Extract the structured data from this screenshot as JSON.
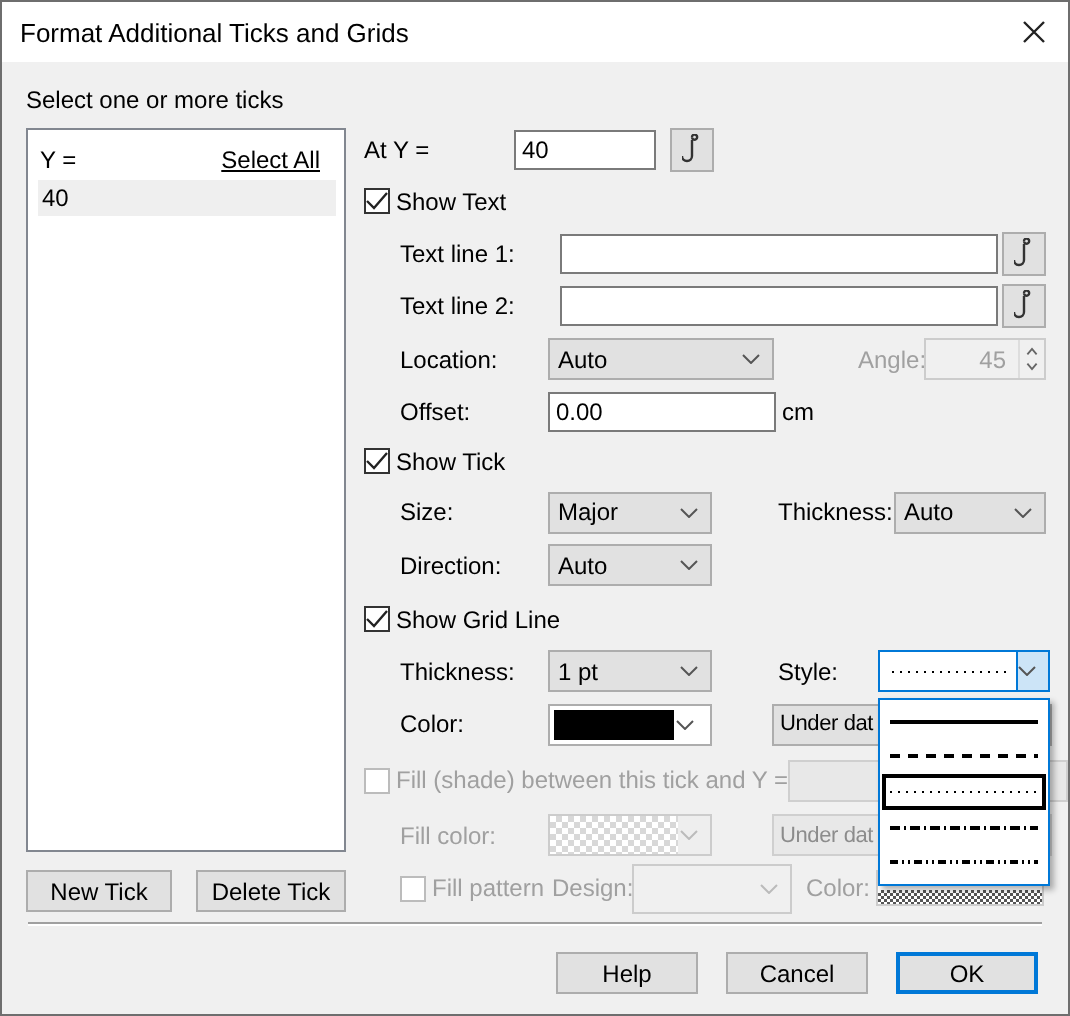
{
  "window": {
    "title": "Format Additional Ticks and Grids"
  },
  "tick_list": {
    "label": "Select one or more ticks",
    "header": "Y =",
    "select_all": "Select All",
    "items": [
      {
        "value": "40",
        "selected": true
      }
    ]
  },
  "list_buttons": [
    "New Tick",
    "Delete Tick"
  ],
  "at_y": {
    "label": "At Y =",
    "value": "40"
  },
  "show_text": {
    "label": "Show Text",
    "checked": true
  },
  "text_line_1": {
    "label": "Text line 1:"
  },
  "text_line_2": {
    "label": "Text line 2:"
  },
  "location": {
    "label": "Location:",
    "value": "Auto"
  },
  "angle": {
    "label": "Angle:",
    "value": "45",
    "disabled": true
  },
  "offset": {
    "label": "Offset:",
    "value": "0.00",
    "unit": "cm"
  },
  "show_tick": {
    "label": "Show Tick",
    "checked": true
  },
  "size": {
    "label": "Size:",
    "value": "Major"
  },
  "tick_thickness": {
    "label": "Thickness:",
    "value": "Auto"
  },
  "direction": {
    "label": "Direction:",
    "value": "Auto"
  },
  "show_grid_line": {
    "label": "Show Grid Line",
    "checked": true
  },
  "grid_thickness": {
    "label": "Thickness:",
    "value": "1 pt"
  },
  "style": {
    "label": "Style:",
    "expanded": true,
    "options": [
      {
        "kind": "solid",
        "selected": false
      },
      {
        "kind": "dash",
        "selected": false
      },
      {
        "kind": "dot",
        "selected": true
      },
      {
        "kind": "dash-dot",
        "selected": false
      },
      {
        "kind": "dash-dot-dot",
        "selected": false
      }
    ]
  },
  "grid_color": {
    "label": "Color:",
    "color": "#000000"
  },
  "grid_layer": {
    "value": "Under dat"
  },
  "fill": {
    "label": "Fill (shade) between this tick and Y =",
    "checked": false,
    "disabled": true
  },
  "fill_color": {
    "label": "Fill color:",
    "disabled": true
  },
  "fill_layer": {
    "value": "Under dat",
    "disabled": true
  },
  "fill_pattern": {
    "label": "Fill pattern",
    "checked": false,
    "disabled": true
  },
  "design": {
    "label": "Design:",
    "disabled": true
  },
  "pattern_color": {
    "label": "Color:",
    "disabled": true
  },
  "buttons": [
    {
      "label": "Help",
      "default": false
    },
    {
      "label": "Cancel",
      "default": false
    },
    {
      "label": "OK",
      "default": true
    }
  ]
}
